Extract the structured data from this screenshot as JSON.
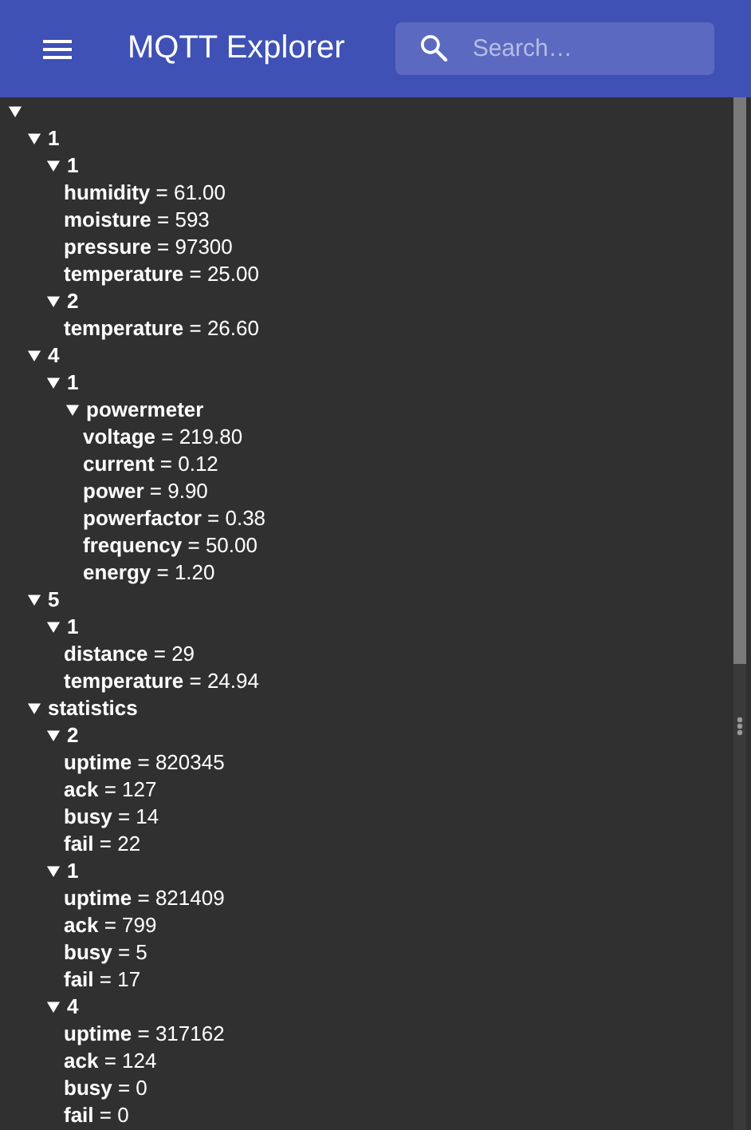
{
  "app_bar": {
    "title": "MQTT Explorer",
    "search": {
      "placeholder": "Search…"
    }
  },
  "tree": {
    "expanded": true,
    "children": [
      {
        "name": "1",
        "expanded": true,
        "children": [
          {
            "name": "1",
            "expanded": true,
            "children": [
              {
                "text": "**humidity** = 61.00"
              },
              {
                "text": "**moisture** = 593"
              },
              {
                "text": "**pressure** = 97300"
              },
              {
                "text": "**temperature** = 25.00"
              }
            ]
          },
          {
            "name": "2",
            "expanded": true,
            "children": [
              {
                "text": "**temperature** = 26.60"
              }
            ]
          }
        ]
      },
      {
        "name": "4",
        "expanded": true,
        "children": [
          {
            "name": "1",
            "expanded": true,
            "children": [
              {
                "name": "powermeter",
                "expanded": true,
                "children": [
                  {
                    "text": "**voltage** = 219.80"
                  },
                  {
                    "text": "**current** = 0.12"
                  },
                  {
                    "text": "**power** = 9.90"
                  },
                  {
                    "text": "**powerfactor** = 0.38"
                  },
                  {
                    "text": "**frequency** = 50.00"
                  },
                  {
                    "text": "**energy** = 1.20"
                  }
                ]
              }
            ]
          }
        ]
      },
      {
        "name": "5",
        "expanded": true,
        "children": [
          {
            "name": "1",
            "expanded": true,
            "children": [
              {
                "text": "**distance** = 29"
              },
              {
                "text": "**temperature** = 24.94"
              }
            ]
          }
        ]
      },
      {
        "name": "statistics",
        "expanded": true,
        "children": [
          {
            "name": "2",
            "expanded": true,
            "children": [
              {
                "text": "**uptime** = 820345"
              },
              {
                "text": "**ack** = 127"
              },
              {
                "text": "**busy** = 14"
              },
              {
                "text": "**fail** = 22"
              }
            ]
          },
          {
            "name": "1",
            "expanded": true,
            "children": [
              {
                "text": "**uptime** = 821409"
              },
              {
                "text": "**ack** = 799"
              },
              {
                "text": "**busy** = 5"
              },
              {
                "text": "**fail** = 17"
              }
            ]
          },
          {
            "name": "4",
            "expanded": true,
            "children": [
              {
                "text": "**uptime** = 317162"
              },
              {
                "text": "**ack** = 124"
              },
              {
                "text": "**busy** = 0"
              },
              {
                "text": "**fail** = 0"
              }
            ]
          }
        ]
      }
    ]
  }
}
